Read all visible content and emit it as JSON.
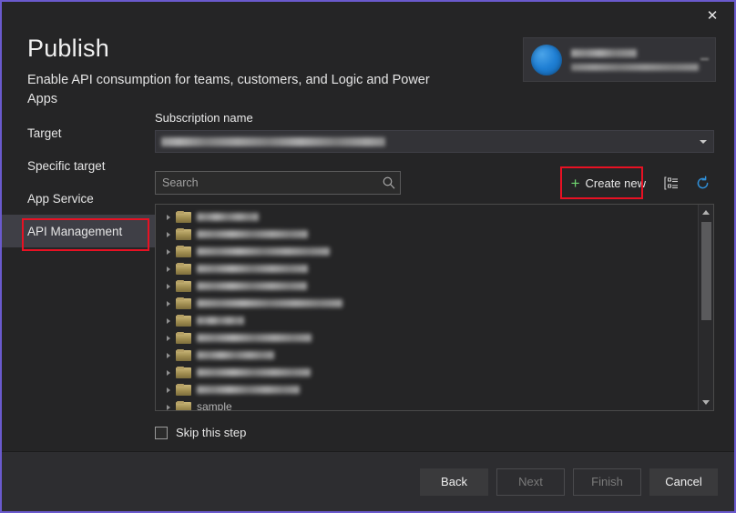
{
  "window": {
    "close_label": "✕",
    "accent_highlight": "#e81123",
    "border_color": "#6a5acd"
  },
  "header": {
    "title": "Publish",
    "subtitle": "Enable API consumption for teams, customers, and Logic and Power Apps"
  },
  "account": {
    "name": "",
    "email": "",
    "avatar_icon": "user-avatar-icon",
    "caret_icon": "chevron-down-icon"
  },
  "sidebar": {
    "items": [
      {
        "label": "Target",
        "selected": false
      },
      {
        "label": "Specific target",
        "selected": false
      },
      {
        "label": "App Service",
        "selected": false
      },
      {
        "label": "API Management",
        "selected": true
      }
    ]
  },
  "main": {
    "subscription": {
      "label": "Subscription name",
      "value": "",
      "caret_icon": "chevron-down-icon"
    },
    "search": {
      "placeholder": "Search",
      "value": "",
      "icon": "search-icon"
    },
    "toolbar": {
      "create_new_label": "Create new",
      "plus_icon": "plus-icon",
      "grouping_icon": "list-grouping-icon",
      "refresh_icon": "refresh-icon",
      "refresh_color": "#2f8fd8",
      "plus_color": "#70d670"
    },
    "tree": {
      "items": [
        {
          "label": "",
          "width": 68
        },
        {
          "label": "",
          "width": 122
        },
        {
          "label": "",
          "width": 146
        },
        {
          "label": "",
          "width": 122
        },
        {
          "label": "",
          "width": 121
        },
        {
          "label": "",
          "width": 160
        },
        {
          "label": "",
          "width": 52
        },
        {
          "label": "",
          "width": 126
        },
        {
          "label": "",
          "width": 85
        },
        {
          "label": "",
          "width": 125
        },
        {
          "label": "",
          "width": 113
        },
        {
          "label": "sample",
          "width": 52
        }
      ],
      "folder_icon": "folder-icon",
      "expander_icon": "chevron-right-icon",
      "scrollbar": {
        "up_icon": "scroll-up-arrow-icon",
        "down_icon": "scroll-down-arrow-icon"
      }
    },
    "skip": {
      "label": "Skip this step",
      "checked": false
    }
  },
  "footer": {
    "buttons": [
      {
        "label": "Back",
        "disabled": false
      },
      {
        "label": "Next",
        "disabled": true
      },
      {
        "label": "Finish",
        "disabled": true
      },
      {
        "label": "Cancel",
        "disabled": false
      }
    ]
  }
}
